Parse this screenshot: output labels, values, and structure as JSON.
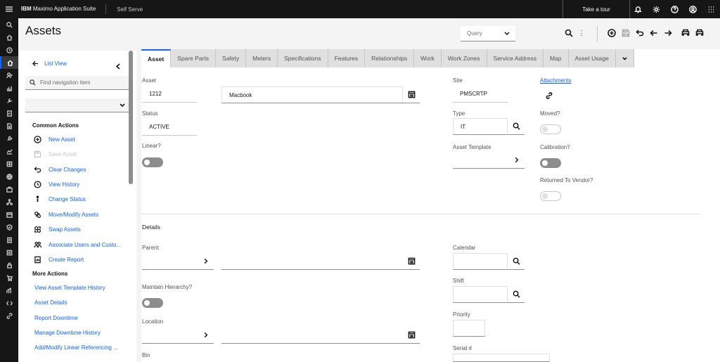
{
  "topbar": {
    "brand_bold": "IBM",
    "brand_rest": " Maximo Application Suite",
    "product": "Self Serve",
    "tour_label": "Take a tour",
    "icons": [
      "hamburger-icon",
      "bell-icon",
      "settings-icon",
      "help-icon",
      "user-icon",
      "app-switcher-icon"
    ]
  },
  "rail": {
    "icons": [
      "search-icon",
      "home-icon",
      "history-icon",
      "home-active-icon",
      "user-add-icon",
      "chart-icon",
      "tools-icon",
      "report-icon",
      "document-icon",
      "wrench-icon",
      "analytics-icon",
      "inventory-icon",
      "globe-icon",
      "briefcase-icon",
      "network-icon",
      "calendar-icon",
      "shield-icon",
      "clipboard-icon",
      "list-icon",
      "lock-icon",
      "cart-icon",
      "growth-icon",
      "code-icon",
      "link-icon"
    ]
  },
  "page": {
    "title": "Assets",
    "query_placeholder": "Query"
  },
  "nav": {
    "list_view": "List View",
    "search_placeholder": "Find navigation item",
    "common_heading": "Common Actions",
    "common_actions": [
      {
        "label": "New Asset",
        "icon": "add-circle-icon",
        "disabled": false
      },
      {
        "label": "Save Asset",
        "icon": "save-icon",
        "disabled": true
      },
      {
        "label": "Clear Changes",
        "icon": "undo-icon",
        "disabled": false
      },
      {
        "label": "View History",
        "icon": "history-icon",
        "disabled": false
      },
      {
        "label": "Change Status",
        "icon": "status-icon",
        "disabled": false
      },
      {
        "label": "Move/Modify Assets",
        "icon": "move-icon",
        "disabled": false
      },
      {
        "label": "Swap Assets",
        "icon": "swap-icon",
        "disabled": false
      },
      {
        "label": "Associate Users and Custo...",
        "icon": "users-icon",
        "disabled": false
      },
      {
        "label": "Create Report",
        "icon": "report-icon",
        "disabled": false
      }
    ],
    "more_heading": "More Actions",
    "more_actions": [
      "View Asset Template History",
      "Asset Details",
      "Report Downtime",
      "Manage Downtime History",
      "Add/Modify Linear Referencing ..."
    ]
  },
  "tabs": [
    "Asset",
    "Spare Parts",
    "Safety",
    "Meters",
    "Specifications",
    "Features",
    "Relationships",
    "Work",
    "Work Zones",
    "Service Address",
    "Map",
    "Asset Usage"
  ],
  "form": {
    "asset_label": "Asset",
    "asset_value": "1212",
    "description_value": "Macbook",
    "status_label": "Status",
    "status_value": "ACTIVE",
    "linear_label": "Linear?",
    "site_label": "Site",
    "site_value": "PMSCRTP",
    "type_label": "Type",
    "type_value": "IT",
    "asset_template_label": "Asset Template",
    "attachments_label": "Attachments",
    "moved_label": "Moved?",
    "calibration_label": "Calibration?",
    "returned_label": "Returned To Vendor?",
    "details_title": "Details",
    "parent_label": "Parent",
    "maintain_label": "Maintain Hierarchy?",
    "location_label": "Location",
    "bin_label": "Bin",
    "calendar_label": "Calendar",
    "shift_label": "Shift",
    "priority_label": "Priority",
    "serial_label": "Serial #"
  }
}
